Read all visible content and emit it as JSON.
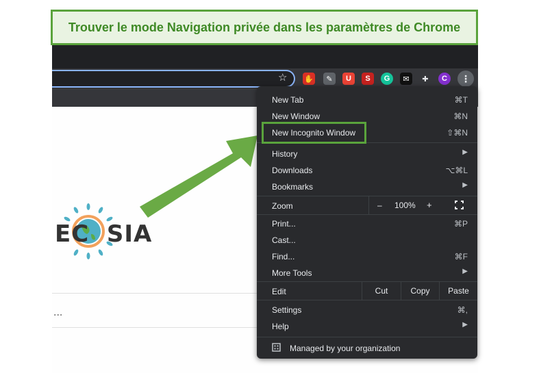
{
  "banner": {
    "text": "Trouver le mode Navigation privée dans les paramètres de Chrome"
  },
  "page": {
    "logo_text": "EC  SIA",
    "ellipsis": "..."
  },
  "extensions": [
    {
      "name": "shield-ext",
      "glyph": "✋",
      "color": "#d93025"
    },
    {
      "name": "edit-ext",
      "glyph": "✎",
      "color": "#5f6368"
    },
    {
      "name": "u-ext",
      "glyph": "U",
      "color": "#ea4335"
    },
    {
      "name": "s-ext",
      "glyph": "S",
      "color": "#c5221f"
    },
    {
      "name": "grammarly-ext",
      "glyph": "G",
      "color": "#15c39a"
    },
    {
      "name": "envelope-ext",
      "glyph": "✉",
      "color": "#111111"
    },
    {
      "name": "puzzle-ext",
      "glyph": "✚",
      "color": "#e8eaed"
    },
    {
      "name": "profile-avatar",
      "glyph": "C",
      "color": "#8430ce"
    }
  ],
  "menu": {
    "new_tab": {
      "label": "New Tab",
      "shortcut": "⌘T"
    },
    "new_window": {
      "label": "New Window",
      "shortcut": "⌘N"
    },
    "new_incognito": {
      "label": "New Incognito Window",
      "shortcut": "⇧⌘N"
    },
    "history": {
      "label": "History"
    },
    "downloads": {
      "label": "Downloads",
      "shortcut": "⌥⌘L"
    },
    "bookmarks": {
      "label": "Bookmarks"
    },
    "zoom": {
      "label": "Zoom",
      "minus": "–",
      "level": "100%",
      "plus": "+"
    },
    "print": {
      "label": "Print...",
      "shortcut": "⌘P"
    },
    "cast": {
      "label": "Cast..."
    },
    "find": {
      "label": "Find...",
      "shortcut": "⌘F"
    },
    "more_tools": {
      "label": "More Tools"
    },
    "edit": {
      "label": "Edit",
      "cut": "Cut",
      "copy": "Copy",
      "paste": "Paste"
    },
    "settings": {
      "label": "Settings",
      "shortcut": "⌘,"
    },
    "help": {
      "label": "Help"
    },
    "managed": {
      "label": "Managed by your organization"
    }
  }
}
